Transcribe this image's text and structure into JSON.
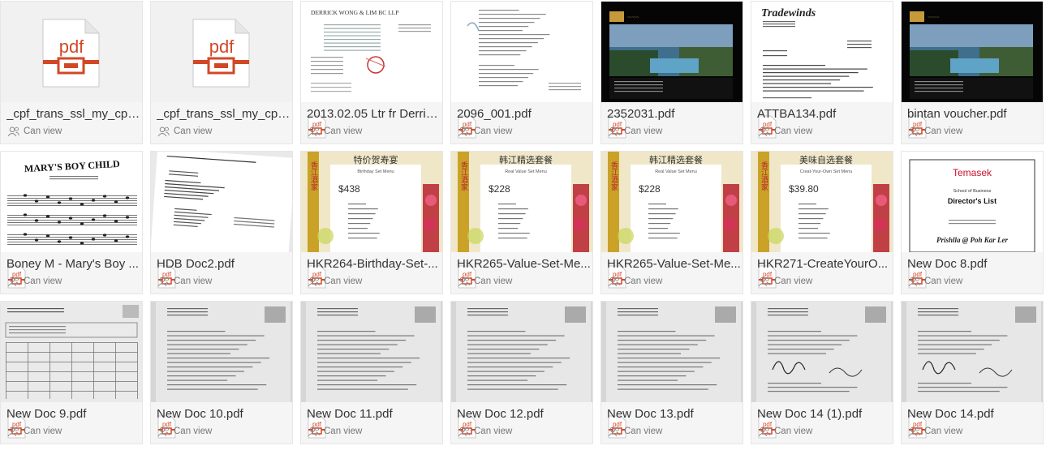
{
  "files": [
    {
      "name": "_cpf_trans_ssl_my_cpf_...",
      "permission": "Can view",
      "thumb": "pdf-icon"
    },
    {
      "name": "_cpf_trans_ssl_my_cpf_...",
      "permission": "Can view",
      "thumb": "pdf-icon"
    },
    {
      "name": "2013.02.05 Ltr fr Derric...",
      "permission": "Can view",
      "thumb": "letter"
    },
    {
      "name": "2096_001.pdf",
      "permission": "Can view",
      "thumb": "upside-letter"
    },
    {
      "name": "2352031.pdf",
      "permission": "Can view",
      "thumb": "resort-dark"
    },
    {
      "name": "ATTBA134.pdf",
      "permission": "Can view",
      "thumb": "tradewinds"
    },
    {
      "name": "bintan voucher.pdf",
      "permission": "Can view",
      "thumb": "resort-dark"
    },
    {
      "name": "Boney M - Mary's Boy ...",
      "permission": "Can view",
      "thumb": "sheet-music"
    },
    {
      "name": "HDB Doc2.pdf",
      "permission": "Can view",
      "thumb": "tilted-letter"
    },
    {
      "name": "HKR264-Birthday-Set-...",
      "permission": "Can view",
      "thumb": "menu"
    },
    {
      "name": "HKR265-Value-Set-Me...",
      "permission": "Can view",
      "thumb": "menu"
    },
    {
      "name": "HKR265-Value-Set-Me...",
      "permission": "Can view",
      "thumb": "menu"
    },
    {
      "name": "HKR271-CreateYourO...",
      "permission": "Can view",
      "thumb": "menu"
    },
    {
      "name": "New Doc 8.pdf",
      "permission": "Can view",
      "thumb": "certificate"
    },
    {
      "name": "New Doc 9.pdf",
      "permission": "Can view",
      "thumb": "form-scan"
    },
    {
      "name": "New Doc 10.pdf",
      "permission": "Can view",
      "thumb": "gray-scan"
    },
    {
      "name": "New Doc 11.pdf",
      "permission": "Can view",
      "thumb": "gray-scan"
    },
    {
      "name": "New Doc 12.pdf",
      "permission": "Can view",
      "thumb": "gray-scan"
    },
    {
      "name": "New Doc 13.pdf",
      "permission": "Can view",
      "thumb": "gray-scan"
    },
    {
      "name": "New Doc 14 (1).pdf",
      "permission": "Can view",
      "thumb": "signed-scan"
    },
    {
      "name": "New Doc 14.pdf",
      "permission": "Can view",
      "thumb": "signed-scan"
    }
  ],
  "thumb_text": {
    "pdf_icon_label": "pdf",
    "badge_label": "pdf",
    "letter_head": "DERRICK WONG & LIM BC LLP",
    "tradewinds_logo": "Tradewinds",
    "sheet_music_title": "MARY'S BOY CHILD",
    "certificate_school": "Temasek",
    "certificate_subtitle": "School of Business",
    "certificate_title": "Director's List",
    "certificate_name": "Prishlla @ Poh Kar Ler",
    "menus": [
      {
        "title": "特价贺寿宴",
        "subtitle": "Birthday Set Menu",
        "price": "$438"
      },
      {
        "title": "韩江精选套餐",
        "subtitle": "Real Value Set Menu",
        "price": "$228"
      },
      {
        "title": "韩江精选套餐",
        "subtitle": "Real Value Set Menu",
        "price": "$228"
      },
      {
        "title": "美味自选套餐",
        "subtitle": "Creat-Your-Own Set Menu",
        "price": "$39.80"
      }
    ]
  },
  "colors": {
    "pdf_orange": "#d24726",
    "tile_bg": "#f5f5f5",
    "menu_gold": "#c9a227",
    "menu_red": "#b8222e",
    "temasek_red": "#c8102e"
  }
}
